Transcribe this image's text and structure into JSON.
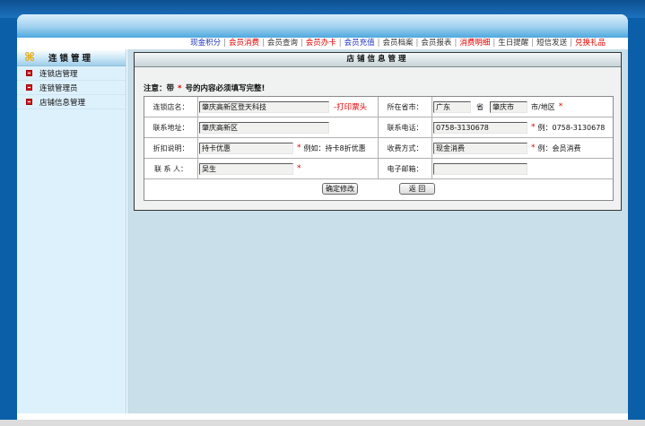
{
  "nav": {
    "items": [
      {
        "label": "现金积分",
        "color": "blue"
      },
      {
        "label": "会员消费",
        "color": "red"
      },
      {
        "label": "会员查询",
        "color": "dark"
      },
      {
        "label": "会员办卡",
        "color": "red"
      },
      {
        "label": "会员充值",
        "color": "blue"
      },
      {
        "label": "会员档案",
        "color": "dark"
      },
      {
        "label": "会员报表",
        "color": "dark"
      },
      {
        "label": "消费明细",
        "color": "red"
      },
      {
        "label": "生日提醒",
        "color": "dark"
      },
      {
        "label": "短信发送",
        "color": "dark"
      },
      {
        "label": "兑换礼品",
        "color": "red"
      }
    ],
    "separator": "|"
  },
  "sidebar": {
    "title": "连锁管理",
    "logo_icon": "⌘",
    "items": [
      {
        "label": "连锁店管理"
      },
      {
        "label": "连锁管理员"
      },
      {
        "label": "店铺信息管理"
      }
    ]
  },
  "panel": {
    "title": "店铺信息管理",
    "notice_prefix": "注意：带",
    "notice_star": "*",
    "notice_suffix": "号的内容必须填写完整!"
  },
  "form": {
    "store_name": {
      "label": "连锁店名：",
      "value": "肇庆高新区登天科技",
      "link": "-打印票头"
    },
    "province": {
      "label": "所在省市：",
      "province_value": "广东",
      "province_unit": "省",
      "city_value": "肇庆市",
      "city_unit": "市/地区",
      "required": "*"
    },
    "address": {
      "label": "联系地址：",
      "value": "肇庆高新区"
    },
    "phone": {
      "label": "联系电话：",
      "value": "0758-3130678",
      "required": "*",
      "hint": "例：0758-3130678"
    },
    "discount": {
      "label": "折扣说明：",
      "value": "持卡优惠",
      "required": "*",
      "hint": "例如：持卡8折优惠"
    },
    "payment": {
      "label": "收费方式：",
      "value": "现金消费",
      "required": "*",
      "hint": "例：会员消费"
    },
    "contact": {
      "label": "联 系 人：",
      "value": "吴生",
      "required": "*"
    },
    "email": {
      "label": "电子邮箱：",
      "value": ""
    }
  },
  "buttons": {
    "confirm": "确定修改",
    "back": "返 回"
  },
  "colors": {
    "nav_blue": "#1d32b8",
    "nav_red": "#e00000",
    "background_blue": "#0b5fa8",
    "content_bg": "#c9dfe9",
    "sidebar_bg": "#ddf1fd"
  }
}
